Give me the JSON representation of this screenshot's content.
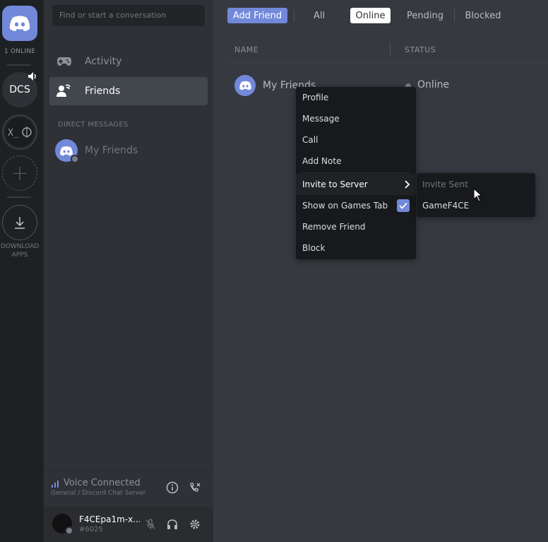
{
  "rail": {
    "online_count": "1 ONLINE",
    "servers": [
      {
        "label": "DCS"
      },
      {
        "label": "X_I@",
        "icon": "avatar-image"
      }
    ],
    "add_server_glyph": "+",
    "download_label_line1": "DOWNLOAD",
    "download_label_line2": "APPS"
  },
  "sidebar": {
    "search_placeholder": "Find or start a conversation",
    "items": [
      {
        "label": "Activity",
        "icon": "gamepad-icon"
      },
      {
        "label": "Friends",
        "icon": "friends-wave-icon"
      }
    ],
    "dm_header": "DIRECT MESSAGES",
    "dms": [
      {
        "label": "My Friends"
      }
    ],
    "voice": {
      "status": "Voice Connected",
      "channel": "General / Discord Chat Server"
    },
    "user": {
      "name": "F4CEpa1m-x...",
      "tag": "#6025"
    }
  },
  "main": {
    "tabs": {
      "add_friend": "Add Friend",
      "all": "All",
      "online": "Online",
      "pending": "Pending",
      "blocked": "Blocked"
    },
    "columns": {
      "name": "NAME",
      "status": "STATUS"
    },
    "friend": {
      "name": "My Friends",
      "status": "Online"
    }
  },
  "context_menu": {
    "items": [
      "Profile",
      "Message",
      "Call",
      "Add Note",
      "Invite to Server",
      "Show on Games Tab",
      "Remove Friend",
      "Block"
    ],
    "submenu": [
      "Invite Sent",
      "GameF4CE"
    ]
  },
  "colors": {
    "accent": "#7289da",
    "rail_bg": "#1e2124",
    "sidebar_bg": "#2f3136",
    "main_bg": "#36393f",
    "menu_bg": "#18191c"
  }
}
